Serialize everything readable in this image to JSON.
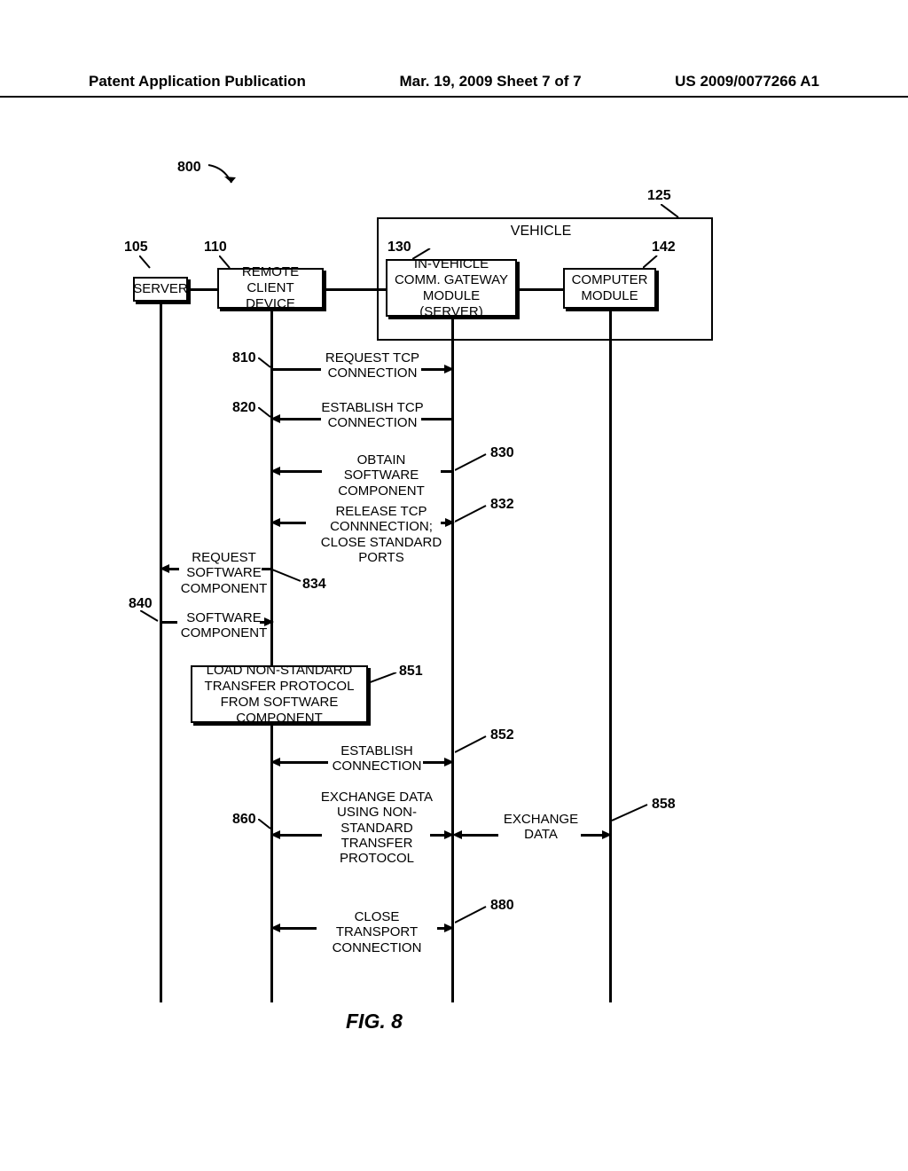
{
  "header": {
    "left": "Patent Application Publication",
    "center": "Mar. 19, 2009  Sheet 7 of 7",
    "right": "US 2009/0077266 A1"
  },
  "refs": {
    "r800": "800",
    "r105": "105",
    "r110": "110",
    "r125": "125",
    "r130": "130",
    "r142": "142",
    "r810": "810",
    "r820": "820",
    "r830": "830",
    "r832": "832",
    "r834": "834",
    "r840": "840",
    "r851": "851",
    "r852": "852",
    "r858": "858",
    "r860": "860",
    "r880": "880"
  },
  "boxes": {
    "server": "SERVER",
    "remote": "REMOTE CLIENT DEVICE",
    "vehicle": "VEHICLE",
    "gateway": "IN-VEHICLE COMM. GATEWAY MODULE (SERVER)",
    "computer": "COMPUTER MODULE",
    "load": "LOAD NON-STANDARD TRANSFER PROTOCOL FROM SOFTWARE COMPONENT"
  },
  "msgs": {
    "m810": "REQUEST TCP CONNECTION",
    "m820": "ESTABLISH TCP CONNECTION",
    "m830": "OBTAIN SOFTWARE COMPONENT",
    "m832": "RELEASE TCP CONNNECTION; CLOSE STANDARD PORTS",
    "m834": "REQUEST SOFTWARE COMPONENT",
    "m840": "SOFTWARE COMPONENT",
    "m852": "ESTABLISH CONNECTION",
    "m860": "EXCHANGE DATA USING NON-STANDARD TRANSFER PROTOCOL",
    "m858": "EXCHANGE DATA",
    "m880": "CLOSE TRANSPORT CONNECTION"
  },
  "figure": "FIG. 8"
}
